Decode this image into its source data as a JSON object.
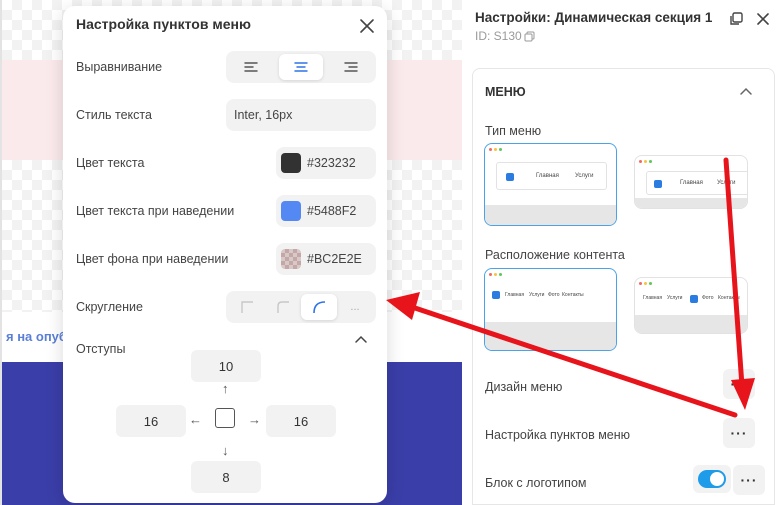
{
  "canvas": {
    "publish_text": "я на опуб"
  },
  "popup": {
    "title": "Настройка пунктов меню",
    "alignment_label": "Выравнивание",
    "text_style_label": "Стиль текста",
    "text_style_value": "Inter, 16px",
    "text_color_label": "Цвет текста",
    "text_color_value": "#323232",
    "hover_text_color_label": "Цвет текста при наведении",
    "hover_text_color_value": "#5488F2",
    "hover_bg_color_label": "Цвет фона при наведении",
    "hover_bg_color_value": "#BC2E2E",
    "radius_label": "Скругление",
    "radius_more": "...",
    "padding_label": "Отступы",
    "padding": {
      "top": "10",
      "left": "16",
      "right": "16",
      "bottom": "8"
    },
    "arrows": {
      "up": "↑",
      "down": "↓",
      "left": "←",
      "right": "→"
    }
  },
  "panel": {
    "title": "Настройки: Динамическая секция 1",
    "id_text": "ID: S130",
    "section_title": "МЕНЮ",
    "menu_type_label": "Тип меню",
    "content_position_label": "Расположение контента",
    "menu_design_label": "Дизайн меню",
    "menu_items_settings_label": "Настройка пунктов меню",
    "logo_block_label": "Блок с логотипом",
    "more_label": "···",
    "thumb1": {
      "item1": "Главная",
      "item2": "Услуги"
    },
    "thumb2": {
      "item1": "Главная",
      "item2": "Услуги"
    },
    "thumb3": {
      "items": [
        "Главная",
        "Услуги",
        "Фото",
        "Контакты"
      ]
    },
    "thumb4": {
      "items": [
        "Главная",
        "Услуги",
        "Фото",
        "Контакты"
      ]
    }
  },
  "colors": {
    "accent": "#2F73E8",
    "toggle": "#1E9BE9",
    "arrow_annotation": "#E8141B",
    "text_color_swatch": "#323232",
    "hover_text_swatch": "#5488F2"
  }
}
